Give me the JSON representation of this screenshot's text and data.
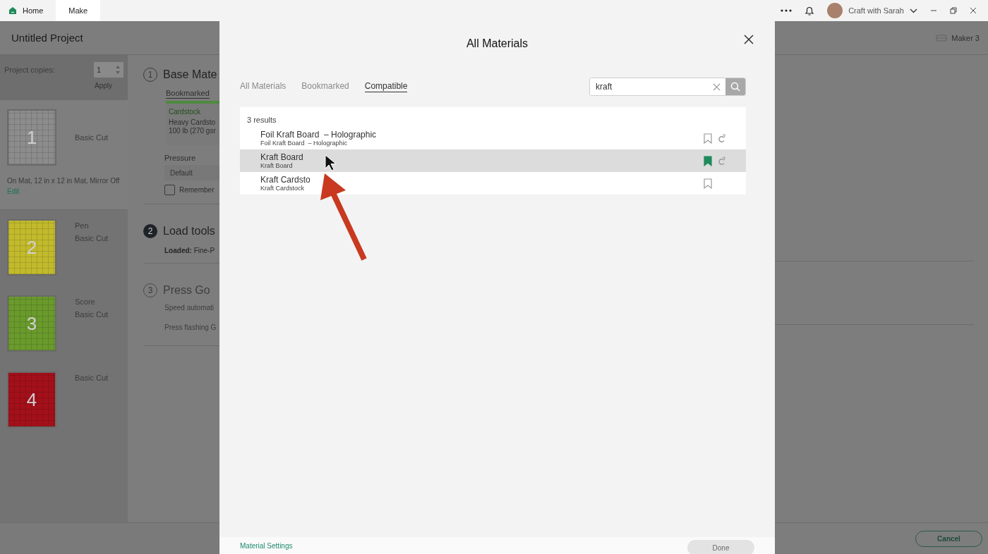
{
  "app_tabs": [
    {
      "label": "Home",
      "selected": false
    },
    {
      "label": "Make",
      "selected": true
    }
  ],
  "account": {
    "name": "Craft with Sarah"
  },
  "project": {
    "title": "Untitled Project",
    "machine": "Maker 3"
  },
  "copies": {
    "label": "Project copies:",
    "value": "1",
    "apply": "Apply"
  },
  "mats": [
    {
      "number": "1",
      "color": "#8c8c8c",
      "lines": [
        "Basic Cut"
      ],
      "selected": true,
      "details": "On Mat, 12 in x 12 in Mat, Mirror Off",
      "edit_link": "Edit"
    },
    {
      "number": "2",
      "color": "#c2ba2c",
      "lines": [
        "Pen",
        "Basic Cut"
      ],
      "selected": false
    },
    {
      "number": "3",
      "color": "#6a9a2c",
      "lines": [
        "Score",
        "Basic Cut"
      ],
      "selected": false
    },
    {
      "number": "4",
      "color": "#a3101a",
      "lines": [
        "Basic Cut"
      ],
      "selected": false
    }
  ],
  "steps": [
    {
      "number": "1",
      "title": "Base Mate",
      "kind": "open",
      "material_tab": "Bookmarked",
      "material": {
        "category": "Cardstock",
        "name": "Heavy Cardsto",
        "weight": "100 lb (270 gsr"
      },
      "pressure_label": "Pressure",
      "pressure_value": "Default",
      "remember": {
        "label": "Remember",
        "checked": false
      }
    },
    {
      "number": "2",
      "title": "Load tools",
      "kind": "active",
      "lines": [
        "**Loaded:** Fine-P"
      ]
    },
    {
      "number": "3",
      "title": "Press Go",
      "kind": "pending",
      "lines": [
        "Speed automati",
        "Press flashing G"
      ]
    }
  ],
  "cancel": "Cancel",
  "dialog": {
    "title": "All Materials",
    "tabs": [
      {
        "label": "All Materials",
        "selected": false
      },
      {
        "label": "Bookmarked",
        "selected": false
      },
      {
        "label": "Compatible",
        "selected": true
      }
    ],
    "search": {
      "value": "kraft"
    },
    "result_count": "3 results",
    "results": [
      {
        "name": "Foil Kraft Board  – Holographic",
        "subtitle": "Foil Kraft Board  – Holographic",
        "bookmarked": false,
        "selected": false,
        "cycle_icon": true
      },
      {
        "name": "Kraft Board",
        "subtitle": "Kraft Board",
        "bookmarked": true,
        "selected": true,
        "cycle_icon": true
      },
      {
        "name": "Kraft Cardsto",
        "subtitle": "Kraft Cardstock",
        "bookmarked": false,
        "selected": false,
        "cycle_icon": false
      }
    ],
    "settings_link": "Material Settings",
    "done": {
      "label": "Done",
      "disabled": true
    }
  }
}
